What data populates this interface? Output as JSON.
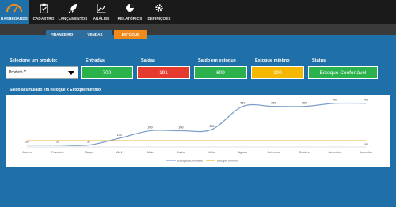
{
  "nav": [
    {
      "label": "DASHBOARDS",
      "icon": "speedometer-icon",
      "active": true
    },
    {
      "label": "CADASTRO",
      "icon": "clipboard-icon",
      "active": false
    },
    {
      "label": "LANÇAMENTOS",
      "icon": "rocket-icon",
      "active": false
    },
    {
      "label": "ANÁLISE",
      "icon": "line-chart-icon",
      "active": false
    },
    {
      "label": "RELATÓRIOS",
      "icon": "pie-chart-icon",
      "active": false
    },
    {
      "label": "DEFINIÇÕES",
      "icon": "gear-icon",
      "active": false
    }
  ],
  "subtabs": [
    {
      "label": "FINANCEIRO",
      "active": false
    },
    {
      "label": "VENDAS",
      "active": false
    },
    {
      "label": "ESTOQUE",
      "active": true
    }
  ],
  "filters": {
    "product_label": "Selecione um produto:",
    "product_value": "Produto Y"
  },
  "kpis": [
    {
      "label": "Entradas",
      "value": "700",
      "color": "#2bb24c"
    },
    {
      "label": "Saídas",
      "value": "191",
      "color": "#e53b2f"
    },
    {
      "label": "Saldo em estoque",
      "value": "609",
      "color": "#2bb24c"
    },
    {
      "label": "Estoque mínimo",
      "value": "100",
      "color": "#f5b800"
    },
    {
      "label": "Status",
      "value": "Estoque Confortável",
      "color": "#2bb24c"
    }
  ],
  "chart_data": {
    "type": "line",
    "title": "Saldo acumulado em estoque x Estoque mínimo",
    "categories": [
      "Janeiro",
      "Fevereiro",
      "Março",
      "Abril",
      "Maio",
      "Junho",
      "Julho",
      "Agosto",
      "Setembro",
      "Outubro",
      "Novembro",
      "Dezembro"
    ],
    "series": [
      {
        "name": "Estoque acumulado",
        "values": [
          30,
          30,
          30,
          140,
          260,
          260,
          280,
          650,
          650,
          650,
          700,
          700
        ],
        "color": "#7fa0cc"
      },
      {
        "name": "Estoque mínimo",
        "values": [
          100,
          100,
          100,
          100,
          100,
          100,
          100,
          100,
          100,
          100,
          100,
          100
        ],
        "color": "#e8b43a"
      }
    ],
    "labels_shown": {
      "accumulated": [
        "30",
        "30",
        "30",
        "140",
        "260",
        "260",
        "280",
        "650",
        "650",
        "650",
        "700",
        "700"
      ],
      "minimum_last": "100"
    },
    "ylim": [
      0,
      760
    ],
    "legend": "bottom",
    "grid": false
  }
}
